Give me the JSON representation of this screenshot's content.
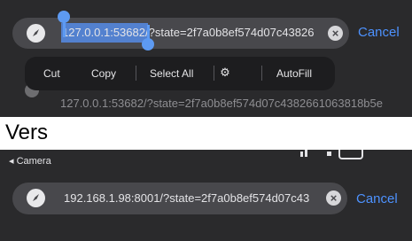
{
  "top": {
    "url_selected": "127.0.0.1:53682",
    "url_rest": "/?state=2f7a0b8ef574d07c43826",
    "cancel": "Cancel",
    "menu": {
      "cut": "Cut",
      "copy": "Copy",
      "select_all": "Select All",
      "autofill": "AutoFill"
    },
    "suggestion_url": "127.0.0.1:53682/?state=2f7a0b8ef574d07c4382661063818b5e"
  },
  "caption": "Vers",
  "bottom": {
    "back_label": "◂ Camera",
    "url": "192.168.1.98:8001/?state=2f7a0b8ef574d07c43",
    "cancel": "Cancel"
  },
  "colors": {
    "accent": "#4d92ff",
    "selection": "#5d9af2",
    "panel_bg": "#2a2a2c",
    "field_bg": "#48484c"
  },
  "icons": [
    "safari-compass-icon",
    "clear-x-icon",
    "autofill-key-icon"
  ]
}
